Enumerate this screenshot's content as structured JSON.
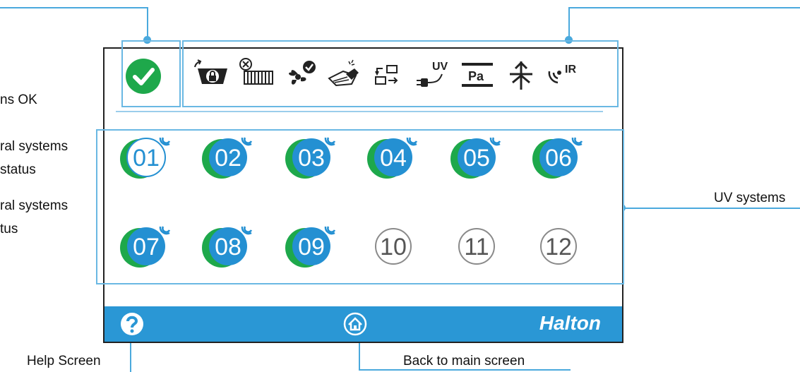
{
  "annotations": {
    "systems_ok": "ns OK",
    "central_systems_1_line1": "ral systems",
    "central_systems_1_line2": "status",
    "central_systems_2_line1": "ral systems",
    "central_systems_2_line2": "tus",
    "uv_systems": "UV systems",
    "help_screen": "Help Screen",
    "back_to_main": "Back to main screen"
  },
  "status": {
    "icon": "check-icon",
    "color": "#1ea84b"
  },
  "system_icons": [
    "hood-lock-icon",
    "filter-fault-icon",
    "fan-ok-icon",
    "hand-clean-icon",
    "switch-io-icon",
    "uv-plug-icon",
    "pressure-icon",
    "fire-damper-icon",
    "ir-signal-icon"
  ],
  "system_text": {
    "uv": "UV",
    "pa": "Pa",
    "ir": "IR"
  },
  "units": [
    {
      "label": "01",
      "state": "active-outline"
    },
    {
      "label": "02",
      "state": "active"
    },
    {
      "label": "03",
      "state": "active"
    },
    {
      "label": "04",
      "state": "active"
    },
    {
      "label": "05",
      "state": "active"
    },
    {
      "label": "06",
      "state": "active"
    },
    {
      "label": "07",
      "state": "active"
    },
    {
      "label": "08",
      "state": "active"
    },
    {
      "label": "09",
      "state": "active"
    },
    {
      "label": "10",
      "state": "inactive"
    },
    {
      "label": "11",
      "state": "inactive"
    },
    {
      "label": "12",
      "state": "inactive"
    }
  ],
  "footer": {
    "help_icon": "help-icon",
    "home_icon": "home-icon",
    "brand": "Halton"
  },
  "colors": {
    "accent_blue": "#2a97d5",
    "unit_blue": "#2490d2",
    "ok_green": "#1ea84b",
    "highlight": "#6ab8e3",
    "inactive_gray": "#8a8a8a"
  }
}
